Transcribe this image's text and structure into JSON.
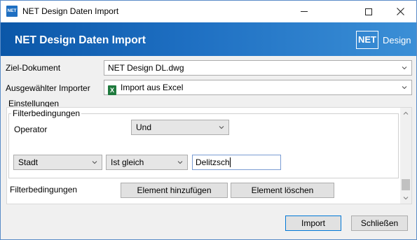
{
  "window": {
    "title": "NET Design Daten Import",
    "icon_text": "NET",
    "icon": "net-design-app-icon",
    "controls": [
      "minimize-icon",
      "maximize-icon",
      "close-icon"
    ]
  },
  "banner": {
    "title": "NET Design Daten Import",
    "logo_box": "NET",
    "logo_text": "Design",
    "colors": {
      "start": "#0b57a8",
      "end": "#3b8fd6"
    }
  },
  "form": {
    "ziel_label": "Ziel-Dokument",
    "ziel_value": "NET Design DL.dwg",
    "importer_label": "Ausgewählter Importer",
    "importer_value": "Import aus Excel",
    "importer_icon": "excel-icon",
    "importer_icon_text": "X"
  },
  "settings": {
    "section_label": "Einstellungen",
    "group_label": "Filterbedingungen",
    "operator_label": "Operator",
    "operator_value": "Und",
    "filter_field": "Stadt",
    "filter_condition": "Ist gleich",
    "filter_value": "Delitzsch",
    "filter_row_label": "Filterbedingungen",
    "add_button": "Element hinzufügen",
    "delete_button": "Element löschen"
  },
  "footer": {
    "import_button": "Import",
    "close_button": "Schließen"
  }
}
